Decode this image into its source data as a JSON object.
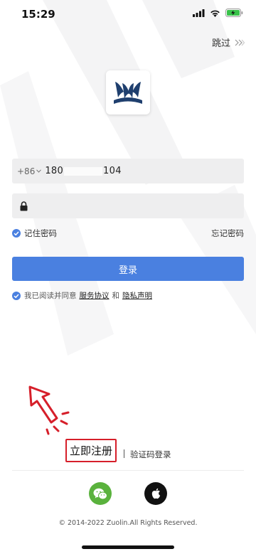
{
  "status_bar": {
    "time": "15:29",
    "icons": [
      "cellular-signal-icon",
      "wifi-icon",
      "battery-charging-icon"
    ]
  },
  "header": {
    "skip_label": "跳过",
    "skip_icon": "double-chevron-right-icon"
  },
  "logo": {
    "icon": "zuolin-logo-icon",
    "color": "#1f3f6e"
  },
  "phone": {
    "country_code": "+86",
    "value_prefix": "180",
    "value_suffix": "104"
  },
  "password": {
    "icon": "lock-icon",
    "value": ""
  },
  "remember": {
    "label": "记住密码",
    "checked": true
  },
  "forgot_label": "忘记密码",
  "login_button": "登录",
  "agreement": {
    "prefix": "我已阅读并同意",
    "service": "服务协议",
    "and": "和",
    "privacy": "隐私声明",
    "checked": true
  },
  "register_label": "立即注册",
  "sms_login_label": "验证码登录",
  "social": [
    "wechat-icon",
    "apple-icon"
  ],
  "copyright": "© 2014-2022 Zuolin.All Rights Reserved.",
  "colors": {
    "accent": "#4a80e0",
    "annotation": "#d61f2a",
    "wechat": "#5ab23d"
  }
}
